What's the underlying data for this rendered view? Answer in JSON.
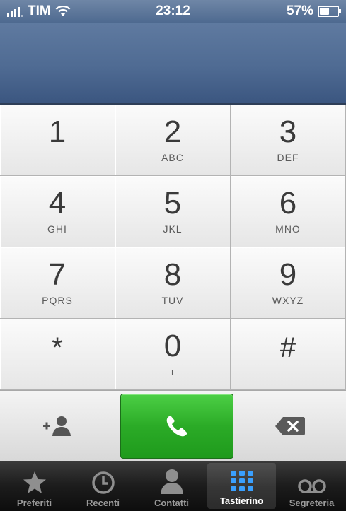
{
  "status_bar": {
    "carrier": "TIM",
    "time": "23:12",
    "battery_percent": "57%",
    "battery_level": 0.57,
    "icons": [
      "signal-icon",
      "wifi-icon",
      "battery-icon"
    ]
  },
  "display": {
    "number": ""
  },
  "keypad": {
    "keys": [
      {
        "digit": "1",
        "letters": ""
      },
      {
        "digit": "2",
        "letters": "ABC"
      },
      {
        "digit": "3",
        "letters": "DEF"
      },
      {
        "digit": "4",
        "letters": "GHI"
      },
      {
        "digit": "5",
        "letters": "JKL"
      },
      {
        "digit": "6",
        "letters": "MNO"
      },
      {
        "digit": "7",
        "letters": "PQRS"
      },
      {
        "digit": "8",
        "letters": "TUV"
      },
      {
        "digit": "9",
        "letters": "WXYZ"
      },
      {
        "digit": "*",
        "letters": ""
      },
      {
        "digit": "0",
        "letters": "+"
      },
      {
        "digit": "#",
        "letters": ""
      }
    ]
  },
  "actions": {
    "add_contact_icon": "add-contact-icon",
    "call_icon": "phone-icon",
    "delete_icon": "backspace-icon",
    "call_color": "#2bab27"
  },
  "tabbar": {
    "tabs": [
      {
        "label": "Preferiti",
        "icon": "star-icon",
        "active": false
      },
      {
        "label": "Recenti",
        "icon": "clock-icon",
        "active": false
      },
      {
        "label": "Contatti",
        "icon": "person-icon",
        "active": false
      },
      {
        "label": "Tastierino",
        "icon": "keypad-icon",
        "active": true
      },
      {
        "label": "Segreteria",
        "icon": "voicemail-icon",
        "active": false
      }
    ]
  },
  "colors": {
    "header_blue": "#4f6b93",
    "tab_active_icon": "#3aa0ff"
  }
}
